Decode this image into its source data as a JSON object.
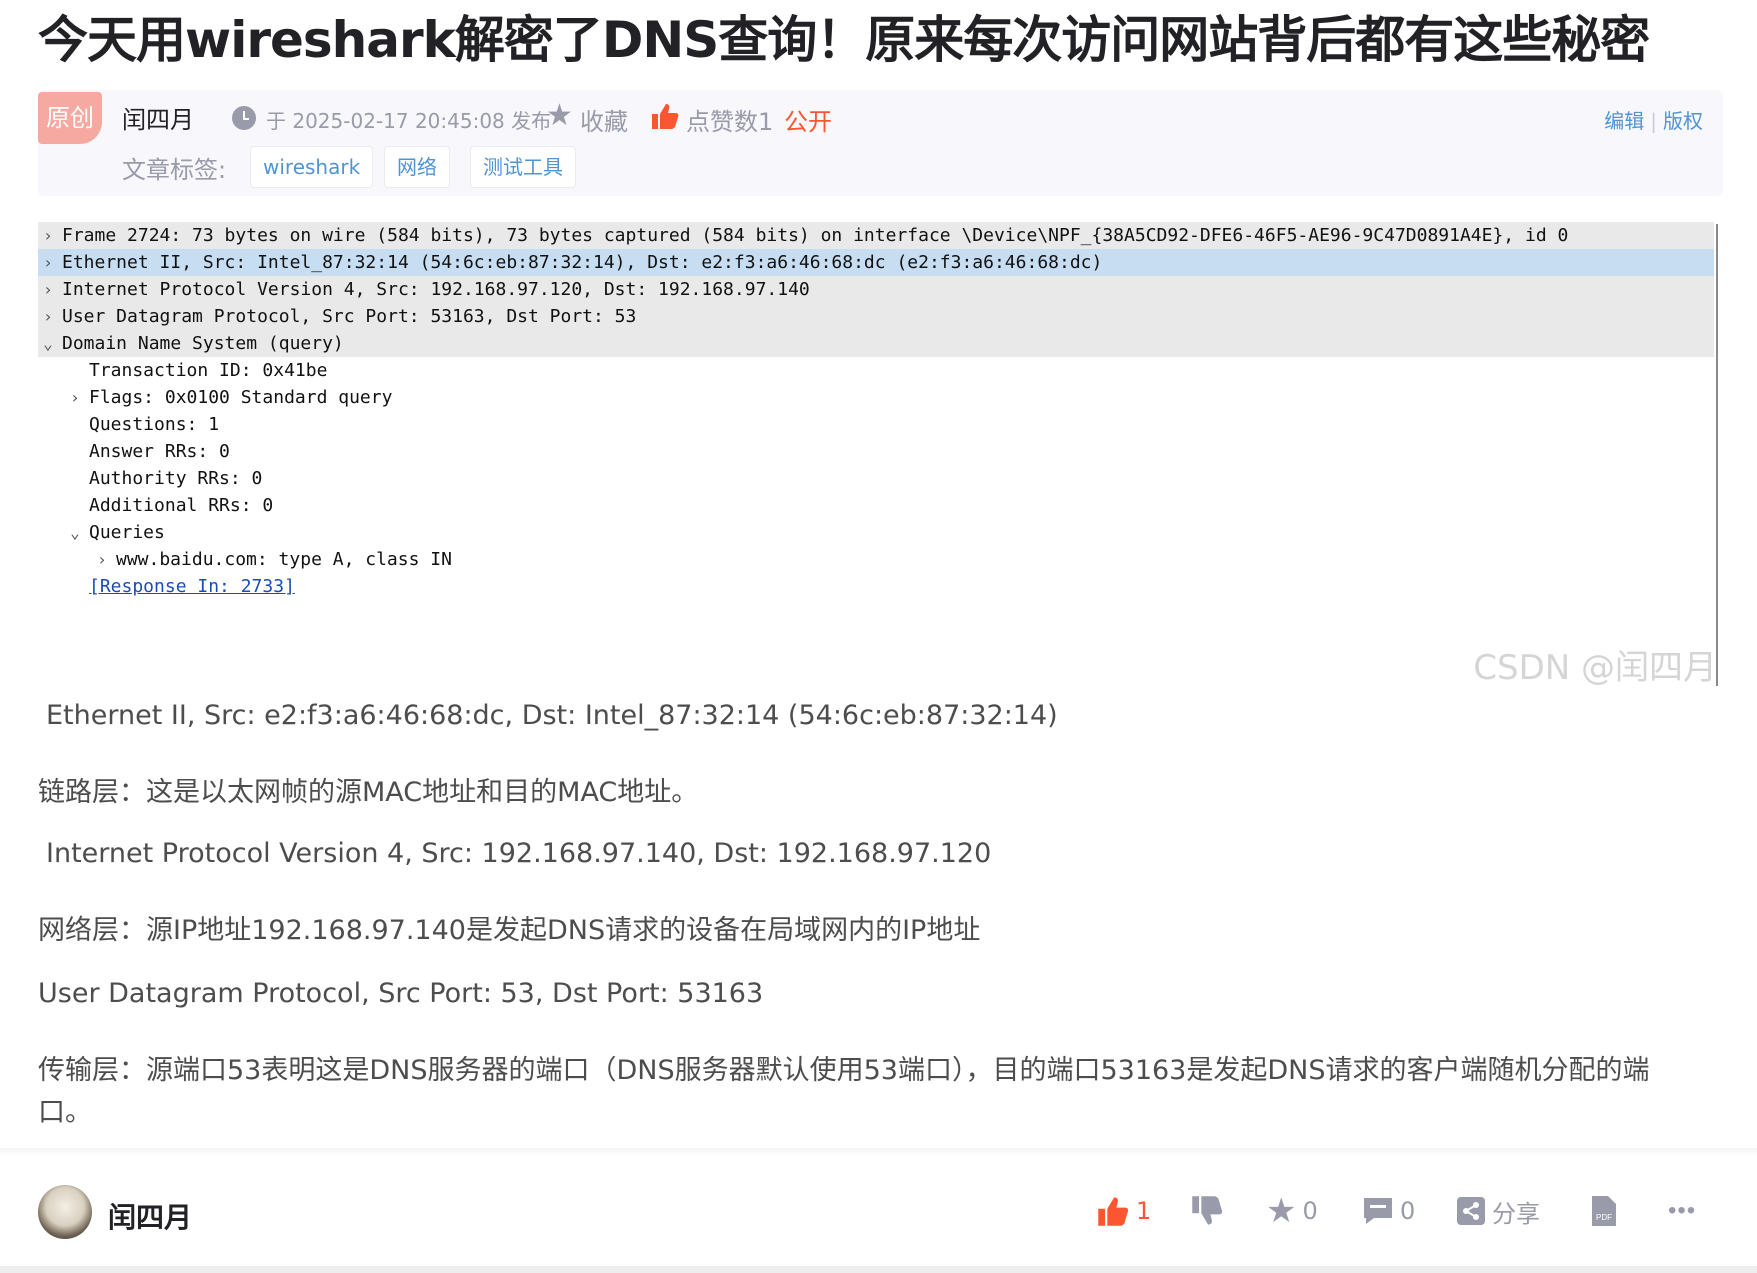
{
  "article": {
    "title": "今天用wireshark解密了DNS查询！原来每次访问网站背后都有这些秘密",
    "badge": "原创",
    "author": "闰四月",
    "publish_time": "于 2025-02-17 20:45:08 发布",
    "collect_label": "收藏",
    "likes_label": "点赞数1",
    "visibility": "公开",
    "edit_label": "编辑",
    "copyright_label": "版权",
    "tags_label": "文章标签:",
    "tags": [
      "wireshark",
      "网络",
      "测试工具"
    ]
  },
  "wireshark": {
    "rows": [
      {
        "arrow": "›",
        "text": "Frame 2724: 73 bytes on wire (584 bits), 73 bytes captured (584 bits) on interface \\Device\\NPF_{38A5CD92-DFE6-46F5-AE96-9C47D0891A4E}, id 0"
      },
      {
        "arrow": "›",
        "text": "Ethernet II, Src: Intel_87:32:14 (54:6c:eb:87:32:14), Dst: e2:f3:a6:46:68:dc (e2:f3:a6:46:68:dc)"
      },
      {
        "arrow": "›",
        "text": "Internet Protocol Version 4, Src: 192.168.97.120, Dst: 192.168.97.140"
      },
      {
        "arrow": "›",
        "text": "User Datagram Protocol, Src Port: 53163, Dst Port: 53"
      },
      {
        "arrow": "⌄",
        "text": "Domain Name System (query)"
      },
      {
        "arrow": "",
        "text": "Transaction ID: 0x41be"
      },
      {
        "arrow": "›",
        "text": "Flags: 0x0100 Standard query"
      },
      {
        "arrow": "",
        "text": "Questions: 1"
      },
      {
        "arrow": "",
        "text": "Answer RRs: 0"
      },
      {
        "arrow": "",
        "text": "Authority RRs: 0"
      },
      {
        "arrow": "",
        "text": "Additional RRs: 0"
      },
      {
        "arrow": "⌄",
        "text": "Queries"
      },
      {
        "arrow": "›",
        "text": "www.baidu.com: type A, class IN"
      },
      {
        "arrow": "",
        "text": "[Response In: 2733]"
      }
    ],
    "watermark": "CSDN @闰四月"
  },
  "body": {
    "p1": "Ethernet II, Src: e2:f3:a6:46:68:dc, Dst: Intel_87:32:14 (54:6c:eb:87:32:14)",
    "p2": "链路层：这是以太网帧的源MAC地址和目的MAC地址。",
    "p3": "Internet Protocol Version 4, Src: 192.168.97.140, Dst: 192.168.97.120",
    "p4": "网络层：源IP地址192.168.97.140是发起DNS请求的设备在局域网内的IP地址",
    "p5": "User Datagram Protocol, Src Port: 53, Dst Port: 53163",
    "p6_line1": "传输层：源端口53表明这是DNS服务器的端口（DNS服务器默认使用53端口），目的端口53163是发起DNS请求的客户端随机分配的端",
    "p6_line2": "口。"
  },
  "footer": {
    "author": "闰四月",
    "like_count": "1",
    "star_count": "0",
    "comment_count": "0",
    "share_label": "分享",
    "more": "•••"
  },
  "colors": {
    "accent_red": "#fc5531",
    "link_blue": "#5094d5",
    "muted": "#999aaa",
    "selected_row": "#c7def2"
  }
}
